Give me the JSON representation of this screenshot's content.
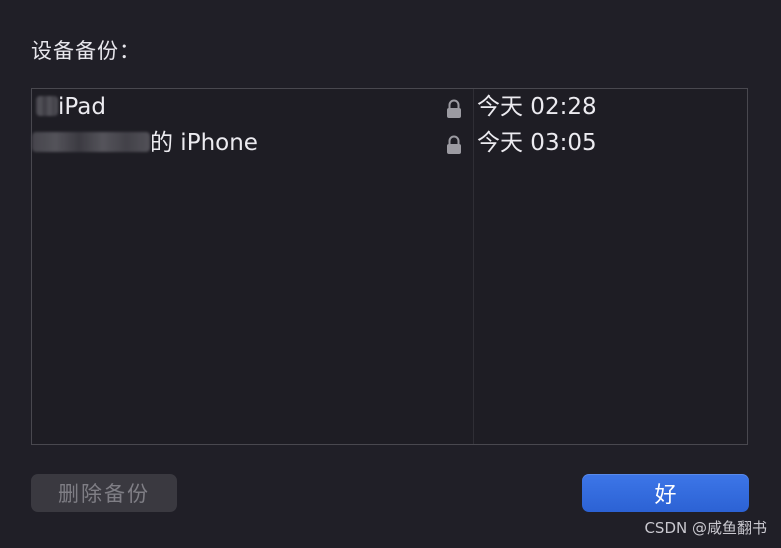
{
  "dialog": {
    "title": "设备备份："
  },
  "backups": [
    {
      "name_suffix": "iPad",
      "locked": true,
      "time": "今天 02:28"
    },
    {
      "name_suffix": "的 iPhone",
      "locked": true,
      "time": "今天 03:05"
    }
  ],
  "buttons": {
    "delete_label": "删除备份",
    "ok_label": "好"
  },
  "watermark": "CSDN @咸鱼翻书",
  "colors": {
    "background": "#201f27",
    "accent": "#2f66db",
    "disabled_button": "#3a3940"
  },
  "icons": {
    "lock": "lock-icon"
  }
}
